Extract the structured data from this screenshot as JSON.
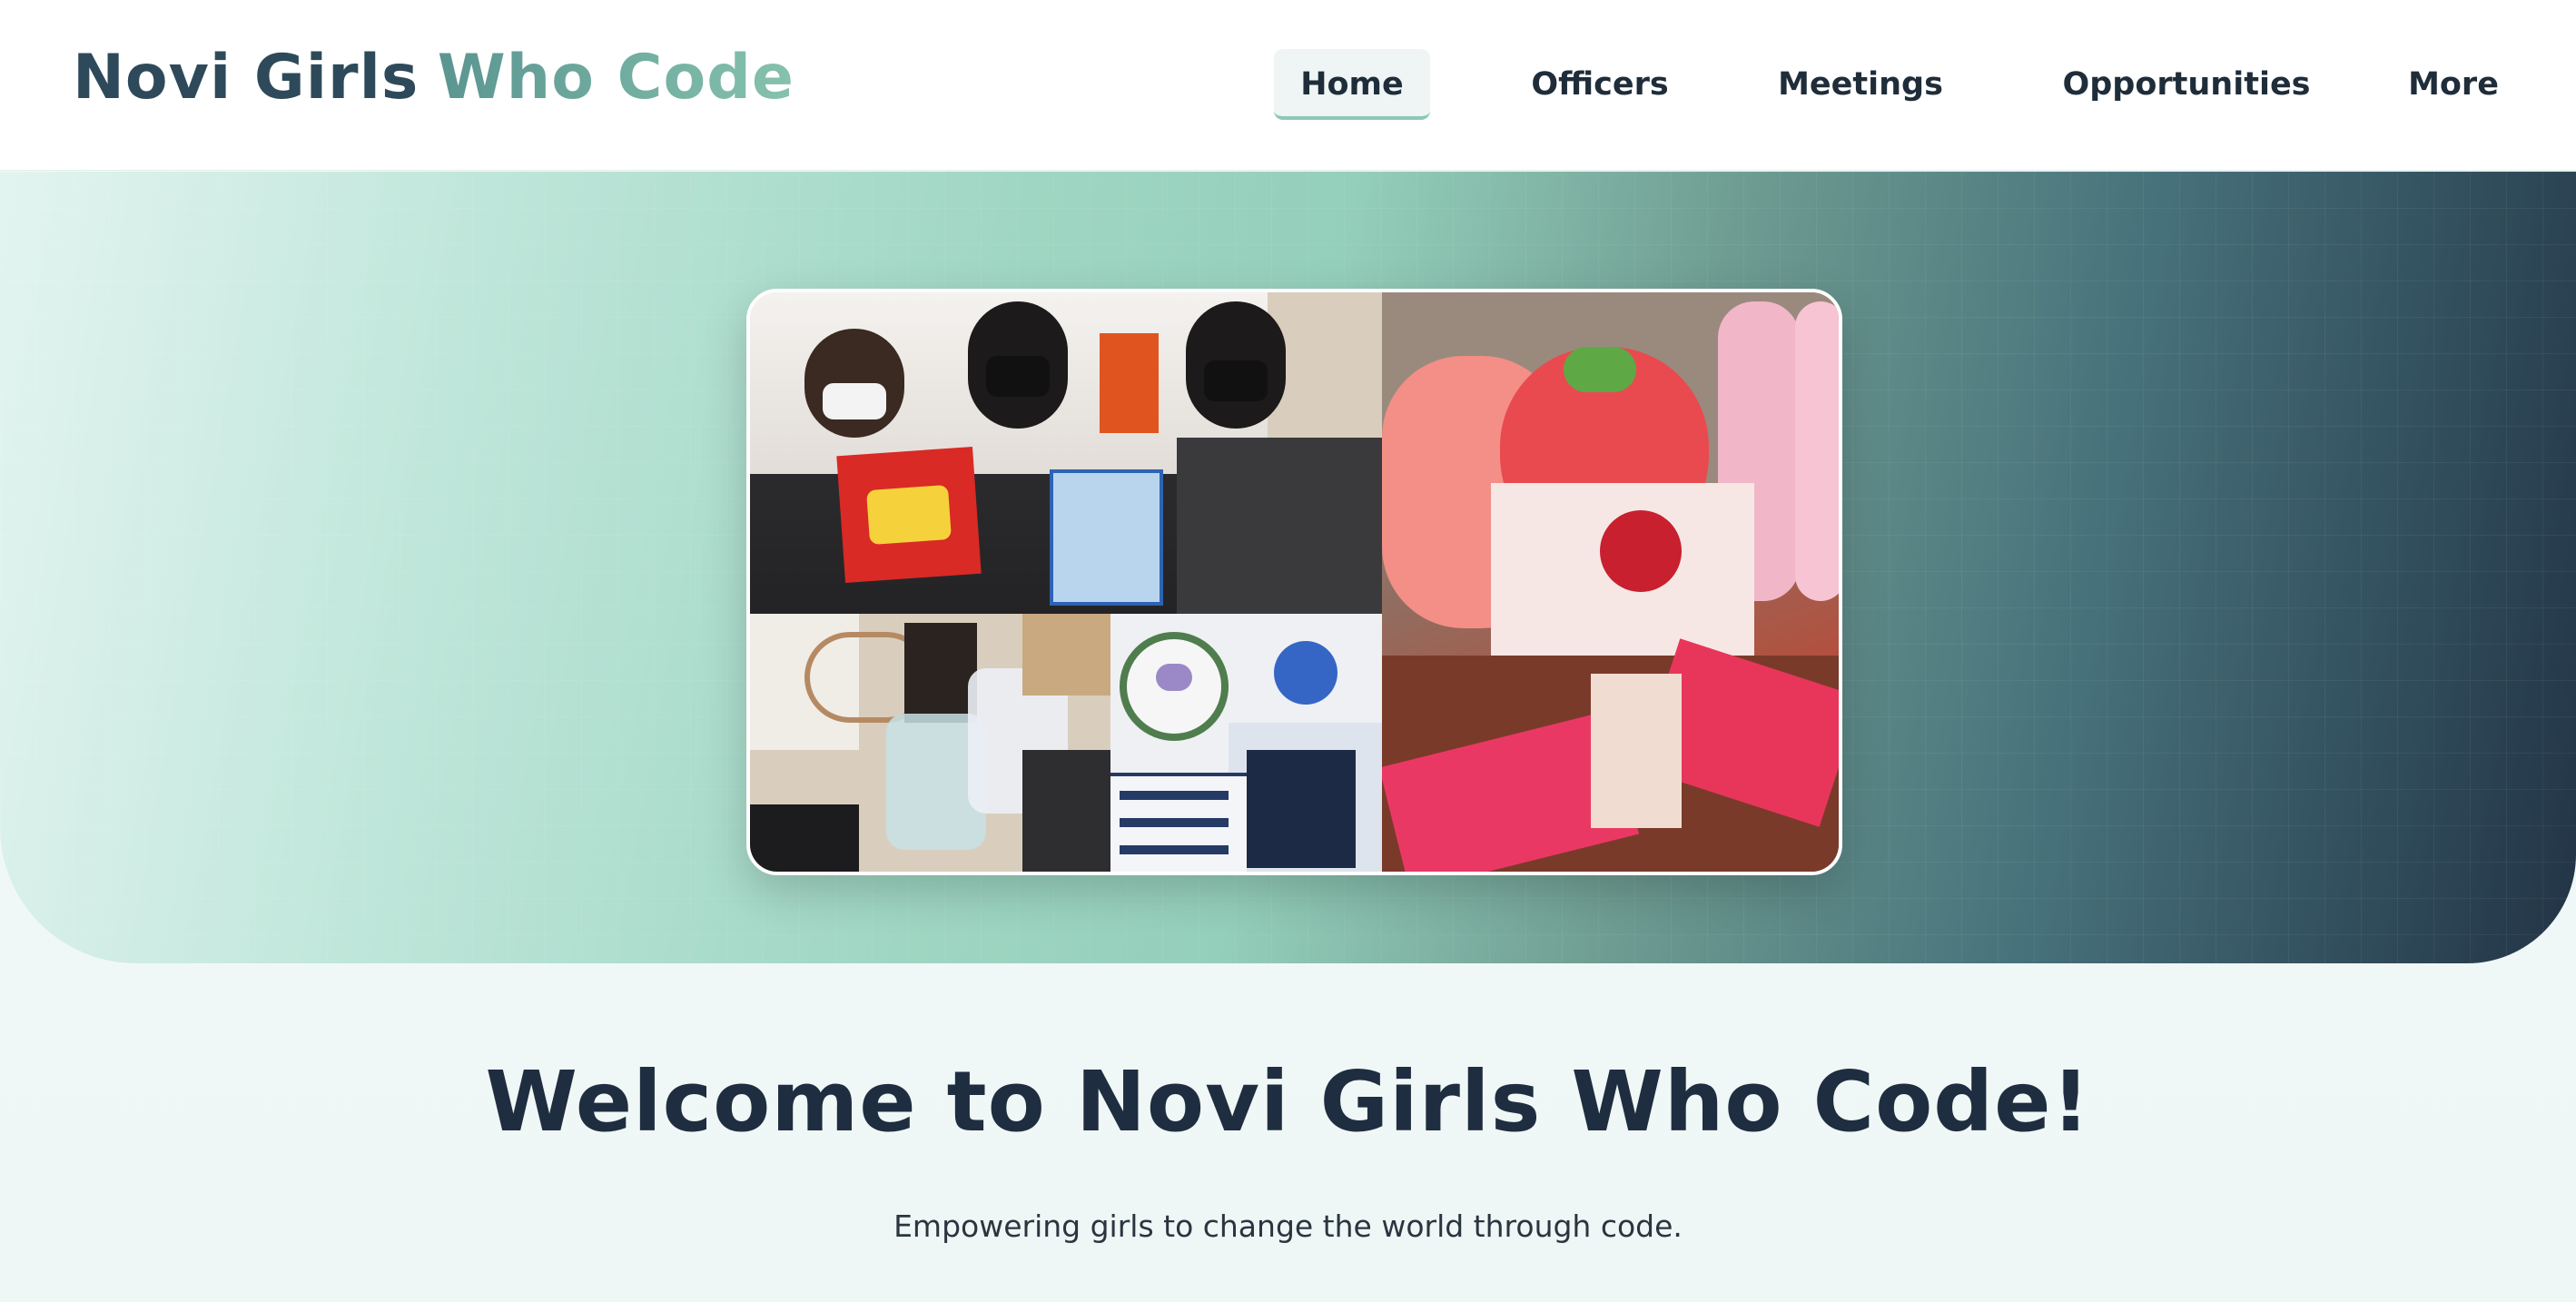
{
  "brand": {
    "part1": "Novi Girls",
    "part2": "Who Code"
  },
  "nav": {
    "items": [
      {
        "label": "Home",
        "active": true
      },
      {
        "label": "Officers",
        "active": false
      },
      {
        "label": "Meetings",
        "active": false
      },
      {
        "label": "Opportunities",
        "active": false
      },
      {
        "label": "More",
        "active": false
      }
    ]
  },
  "hero": {
    "image_alt": "Collage of club members and giveaway items"
  },
  "welcome": {
    "title": "Welcome to Novi Girls Who Code!",
    "subtitle": "Empowering girls to change the world through code."
  },
  "colors": {
    "brand_dark": "#2e4a5a",
    "brand_accent": "#86c2ad",
    "title": "#1f2d40",
    "active_underline": "#8cc8b5"
  }
}
